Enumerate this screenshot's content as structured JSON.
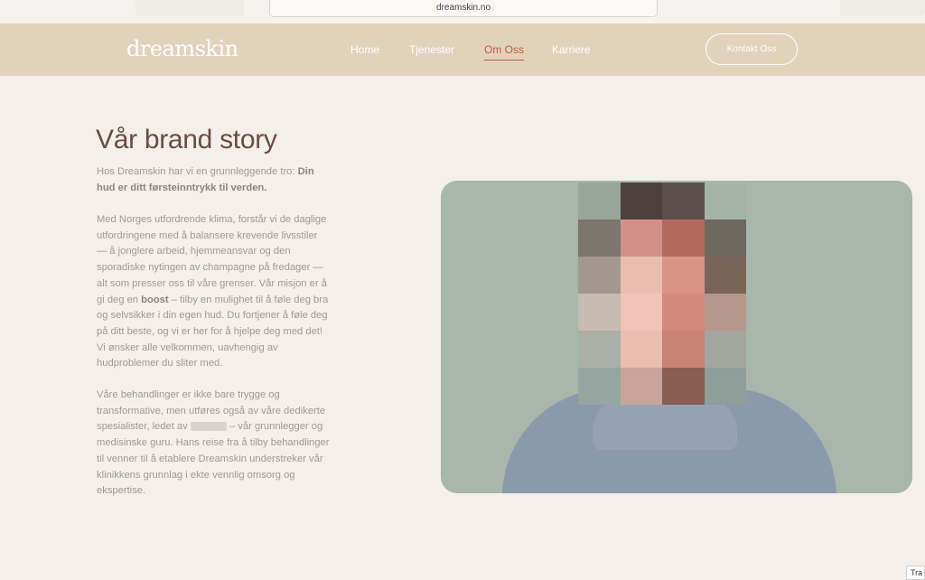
{
  "browser": {
    "url": "dreamskin.no"
  },
  "nav": {
    "logo": "dreamskin",
    "items": [
      {
        "label": "Home",
        "active": false
      },
      {
        "label": "Tjenester",
        "active": false
      },
      {
        "label": "Om Oss",
        "active": true
      },
      {
        "label": "Karriere",
        "active": false
      }
    ],
    "cta": "Kontakt Oss"
  },
  "story": {
    "title": "Vår brand story",
    "p1_lead": "Hos Dreamskin har vi en grunnleggende tro: ",
    "p1_bold": "Din hud er ditt førsteinntrykk til verden.",
    "p2_a": "Med Norges utfordrende klima, forstår vi de daglige utfordringene med å balansere krevende livsstiler — å jonglere arbeid, hjemmeansvar og den sporadiske nytingen av champagne på fredager — alt som presser oss til våre grenser. Vår misjon er å gi deg en ",
    "p2_bold": "boost",
    "p2_b": " – tilby en mulighet til å føle deg bra og selvsikker i din egen hud. Du fortjener å føle deg på ditt beste, og vi er her for å hjelpe deg med det! Vi ønsker alle velkommen, uavhengig av hudproblemer du sliter med.",
    "p3_a": "Våre behandlinger er ikke bare trygge og transformative, men utføres også av våre dedikerte spesialister, ledet av ",
    "p3_b": " – vår grunnlegger og medisinske guru. Hans reise fra å tilby behandlinger til venner til å etablere Dreamskin understreker vår klinikkens grunnlag i ekte vennlig omsorg og ekspertise."
  },
  "translate_tab": "Tra",
  "colors": {
    "nav_bg": "#e1d2bc",
    "page_bg": "#f4efeb",
    "accent": "#c25a45",
    "title": "#6a4c43",
    "photo_bg": "#a7b7ab"
  },
  "mosaic_colors": [
    "#98a69c",
    "#4f4040",
    "#5c504d",
    "#a3b3a8",
    "#7c766e",
    "#d3908a",
    "#b56a5e",
    "#6e6861",
    "#a4988e",
    "#ebbcb0",
    "#d99483",
    "#7a6459",
    "#c8bcb1",
    "#f1c3b8",
    "#d3897c",
    "#b6978d",
    "#acaea8",
    "#ebbcb0",
    "#c88276",
    "#a3a59f",
    "#96a6a0",
    "#c9a49a",
    "#8a5e52",
    "#8e9e99"
  ]
}
